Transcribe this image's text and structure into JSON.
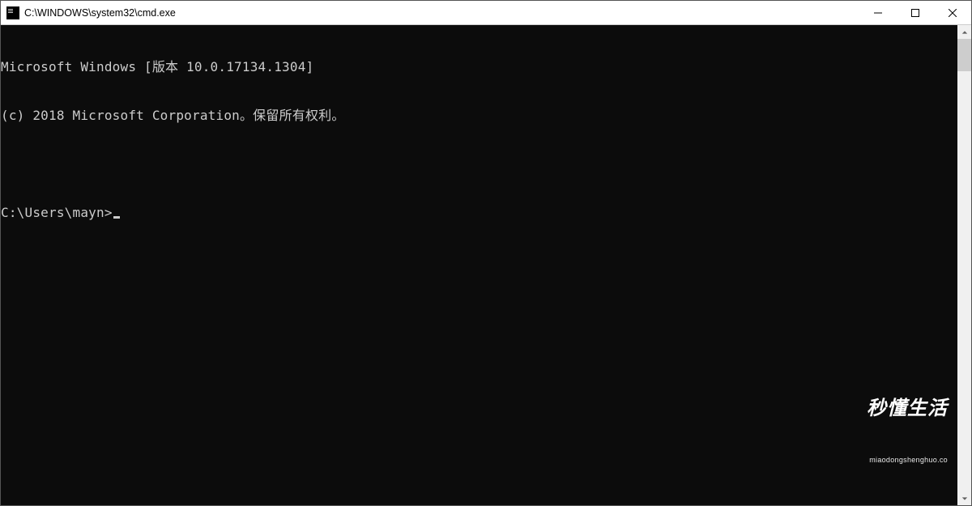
{
  "titlebar": {
    "title": "C:\\WINDOWS\\system32\\cmd.exe"
  },
  "terminal": {
    "line1": "Microsoft Windows [版本 10.0.17134.1304]",
    "line2": "(c) 2018 Microsoft Corporation。保留所有权利。",
    "blank": "",
    "prompt": "C:\\Users\\mayn>"
  },
  "watermark": {
    "big": "秒懂生活",
    "small": "miaodongshenghuo.co"
  }
}
